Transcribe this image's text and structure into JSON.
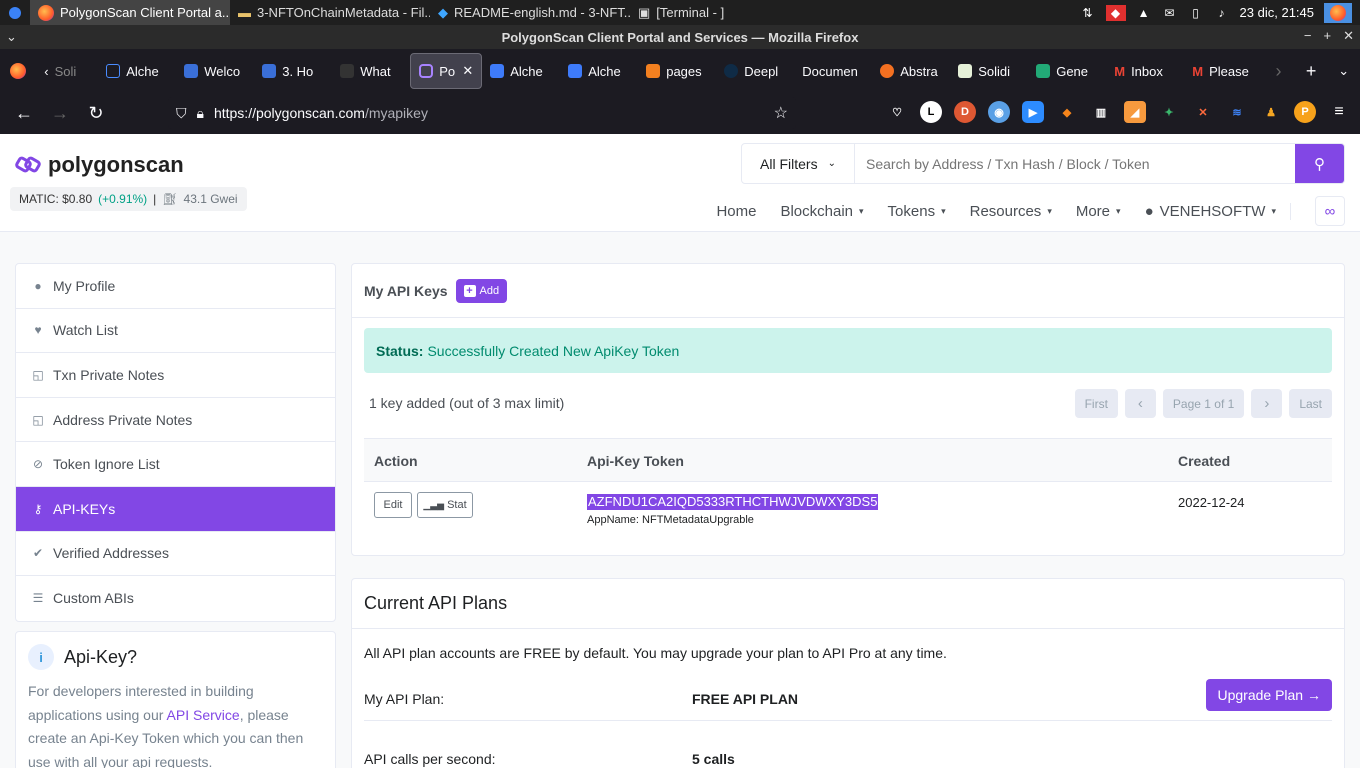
{
  "taskbar": {
    "tasks": [
      {
        "label": "PolygonScan Client Portal a..."
      },
      {
        "label": "3-NFTOnChainMetadata - Fil..."
      },
      {
        "label": "README-english.md - 3-NFT..."
      },
      {
        "label": "[Terminal - ]"
      }
    ],
    "clock": "23 dic, 21:45"
  },
  "window": {
    "title": "PolygonScan Client Portal and Services — Mozilla Firefox"
  },
  "tabs": [
    {
      "label": "Soli"
    },
    {
      "label": "Alche"
    },
    {
      "label": "Welco"
    },
    {
      "label": "3. Ho"
    },
    {
      "label": "What"
    },
    {
      "label": "Po"
    },
    {
      "label": "Alche"
    },
    {
      "label": "Alche"
    },
    {
      "label": "pages"
    },
    {
      "label": "Deepl"
    },
    {
      "label": "Documen"
    },
    {
      "label": "Abstra"
    },
    {
      "label": "Solidi"
    },
    {
      "label": "Gene"
    },
    {
      "label": "Inbox"
    },
    {
      "label": "Please"
    }
  ],
  "url": {
    "host": "https://polygonscan.com",
    "path": "/myapikey"
  },
  "site": {
    "logo_text": "polygonscan",
    "matic_price": "MATIC: $0.80",
    "matic_change": "(+0.91%)",
    "separator": "|",
    "gas": "43.1 Gwei",
    "filter_label": "All Filters",
    "search_placeholder": "Search by Address / Txn Hash / Block / Token",
    "menu": {
      "home": "Home",
      "blockchain": "Blockchain",
      "tokens": "Tokens",
      "resources": "Resources",
      "more": "More",
      "user": "VENEHSOFTW"
    }
  },
  "sidebar": {
    "items": [
      {
        "label": "My Profile",
        "icon": "user-icon"
      },
      {
        "label": "Watch List",
        "icon": "heart-icon"
      },
      {
        "label": "Txn Private Notes",
        "icon": "note-icon"
      },
      {
        "label": "Address Private Notes",
        "icon": "note-icon"
      },
      {
        "label": "Token Ignore List",
        "icon": "eye-slash-icon"
      },
      {
        "label": "API-KEYs",
        "icon": "key-icon"
      },
      {
        "label": "Verified Addresses",
        "icon": "check-badge-icon"
      },
      {
        "label": "Custom ABIs",
        "icon": "list-icon"
      }
    ]
  },
  "info": {
    "title": "Api-Key?",
    "text_before": "For developers interested in building applications using our ",
    "link": "API Service",
    "text_after": ", please create an Api-Key Token which you can then use with all your api requests."
  },
  "apikeys": {
    "title": "My API Keys",
    "add_label": "Add",
    "status_label": "Status:",
    "status_text": "Successfully Created New ApiKey Token",
    "count_text": "1 key added (out of 3 max limit)",
    "pager": {
      "first": "First",
      "prev": "‹",
      "page": "Page 1 of 1",
      "next": "›",
      "last": "Last"
    },
    "columns": {
      "action": "Action",
      "token": "Api-Key Token",
      "created": "Created"
    },
    "rows": [
      {
        "edit_label": "Edit",
        "stat_label": "Stat",
        "token": "AZFNDU1CA2IQD5333RTHCTHWJVDWXY3DS5",
        "app_name": "AppName: NFTMetadataUpgrable",
        "created": "2022-12-24"
      }
    ]
  },
  "plans": {
    "title": "Current API Plans",
    "description": "All API plan accounts are FREE by default. You may upgrade your plan to API Pro at any time.",
    "rows": [
      {
        "label": "My API Plan:",
        "value": "FREE API PLAN"
      },
      {
        "label": "API calls per second:",
        "value": "5 calls"
      }
    ],
    "upgrade_label": "Upgrade Plan →"
  },
  "colors": {
    "brand": "#8247e5",
    "success_bg": "#ccf3ec",
    "success_text": "#008b6e"
  }
}
